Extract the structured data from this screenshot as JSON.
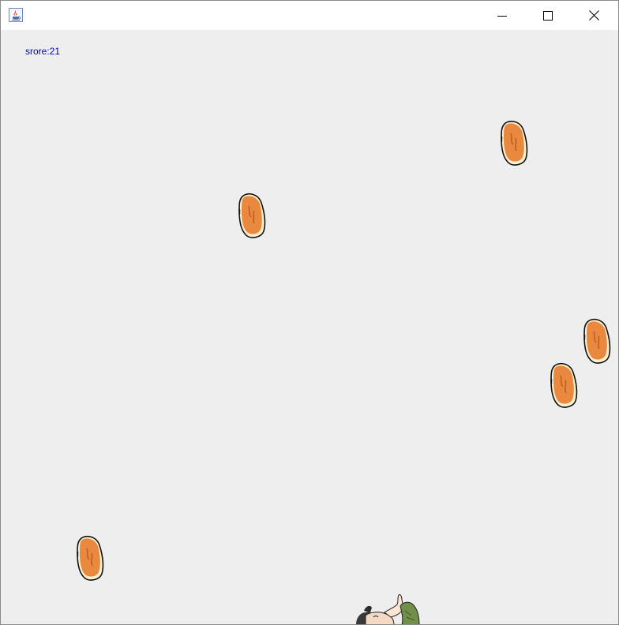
{
  "window": {
    "title": "",
    "icon": "java-cup-icon",
    "controls": [
      "minimize",
      "maximize",
      "close"
    ]
  },
  "game": {
    "score_text": "srore:21",
    "score_color": "#0000c8",
    "background": "#eeeeee",
    "falling_item": "chicken-nugget",
    "falling_item_count": 5,
    "player": "character-catcher"
  }
}
